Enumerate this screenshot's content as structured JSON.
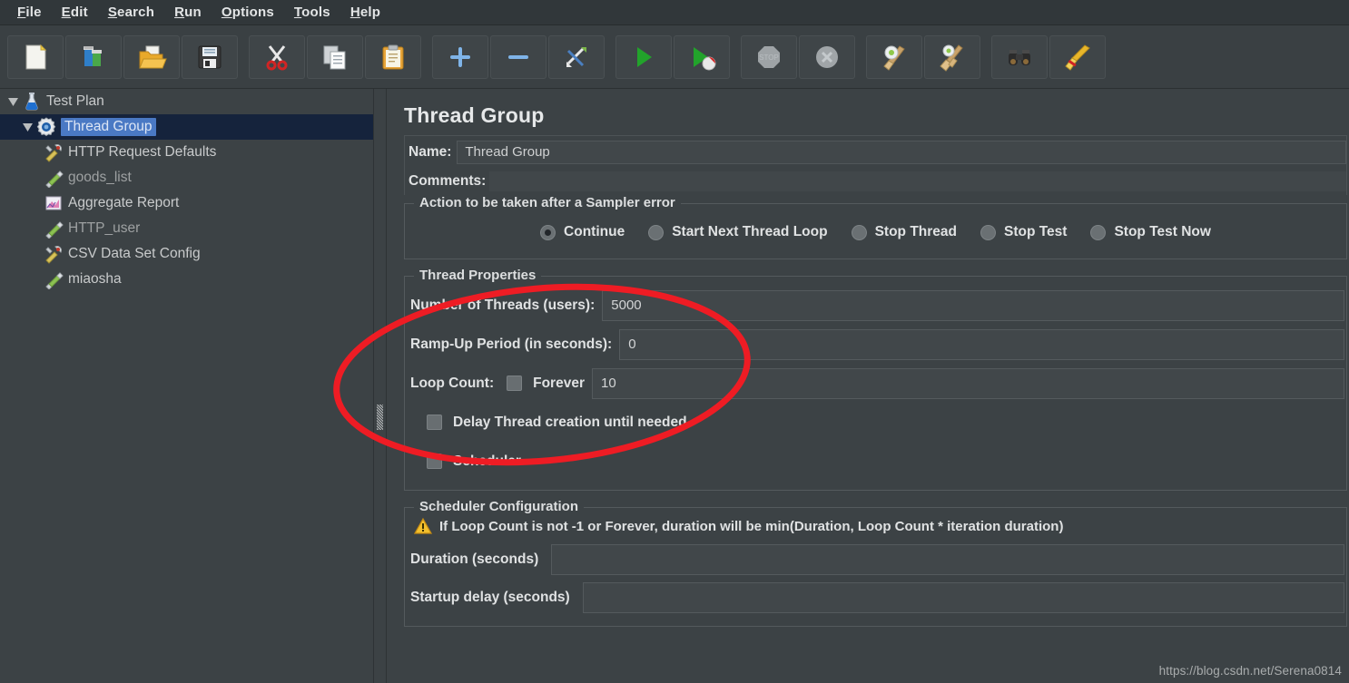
{
  "window": {
    "title": "Thread Group",
    "bg_color": "#3c4245",
    "accent_color": "#4a79c4",
    "annotation_color": "#ee1c24"
  },
  "menubar": {
    "items": [
      {
        "label": "File",
        "mnemonic": "F"
      },
      {
        "label": "Edit",
        "mnemonic": "E"
      },
      {
        "label": "Search",
        "mnemonic": "S"
      },
      {
        "label": "Run",
        "mnemonic": "R"
      },
      {
        "label": "Options",
        "mnemonic": "O"
      },
      {
        "label": "Tools",
        "mnemonic": "T"
      },
      {
        "label": "Help",
        "mnemonic": "H"
      }
    ]
  },
  "toolbar": {
    "buttons": [
      {
        "icon": "new-document-icon",
        "label": "New"
      },
      {
        "icon": "templates-icon",
        "label": "Templates"
      },
      {
        "icon": "open-folder-icon",
        "label": "Open"
      },
      {
        "icon": "save-floppy-icon",
        "label": "Save"
      },
      {
        "icon": "cut-scissors-icon",
        "label": "Cut"
      },
      {
        "icon": "copy-pages-icon",
        "label": "Copy"
      },
      {
        "icon": "paste-clipboard-icon",
        "label": "Paste"
      },
      {
        "icon": "expand-plus-icon",
        "label": "Expand All"
      },
      {
        "icon": "collapse-minus-icon",
        "label": "Collapse All"
      },
      {
        "icon": "toggle-enable-icon",
        "label": "Toggle"
      },
      {
        "icon": "start-play-icon",
        "label": "Start"
      },
      {
        "icon": "start-no-pauses-icon",
        "label": "Start no pauses"
      },
      {
        "icon": "stop-octagon-icon",
        "label": "Stop"
      },
      {
        "icon": "shutdown-circle-icon",
        "label": "Shutdown"
      },
      {
        "icon": "clear-broom-gear-icon",
        "label": "Clear"
      },
      {
        "icon": "clear-all-broom-icon",
        "label": "Clear All"
      },
      {
        "icon": "search-binoculars-icon",
        "label": "Search"
      },
      {
        "icon": "reset-broom-icon",
        "label": "Reset Search"
      }
    ]
  },
  "tree": {
    "items": [
      {
        "label": "Test Plan",
        "icon": "test-plan-flask-icon",
        "indent": 0,
        "toggle": "expanded",
        "selected": false,
        "enabled": true
      },
      {
        "label": "Thread Group",
        "icon": "thread-group-gear-icon",
        "indent": 1,
        "toggle": "expanded",
        "selected": true,
        "enabled": true
      },
      {
        "label": "HTTP Request Defaults",
        "icon": "config-wrench-icon",
        "indent": 2,
        "toggle": "none",
        "selected": false,
        "enabled": true
      },
      {
        "label": "goods_list",
        "icon": "sampler-pen-icon",
        "indent": 2,
        "toggle": "none",
        "selected": false,
        "enabled": false
      },
      {
        "label": "Aggregate Report",
        "icon": "listener-chart-icon",
        "indent": 2,
        "toggle": "none",
        "selected": false,
        "enabled": true
      },
      {
        "label": "HTTP_user",
        "icon": "sampler-pen-icon",
        "indent": 2,
        "toggle": "none",
        "selected": false,
        "enabled": false
      },
      {
        "label": "CSV Data Set Config",
        "icon": "config-wrench-icon",
        "indent": 2,
        "toggle": "none",
        "selected": false,
        "enabled": true
      },
      {
        "label": "miaosha",
        "icon": "sampler-pen-icon",
        "indent": 2,
        "toggle": "none",
        "selected": false,
        "enabled": true
      }
    ]
  },
  "panel": {
    "title": "Thread Group",
    "name_label": "Name:",
    "name_value": "Thread Group",
    "comments_label": "Comments:",
    "comments_value": "",
    "sampler_error": {
      "legend": "Action to be taken after a Sampler error",
      "options": [
        {
          "label": "Continue",
          "checked": true
        },
        {
          "label": "Start Next Thread Loop",
          "checked": false
        },
        {
          "label": "Stop Thread",
          "checked": false
        },
        {
          "label": "Stop Test",
          "checked": false
        },
        {
          "label": "Stop Test Now",
          "checked": false
        }
      ]
    },
    "thread_properties": {
      "legend": "Thread Properties",
      "num_threads_label": "Number of Threads (users):",
      "num_threads_value": "5000",
      "ramp_up_label": "Ramp-Up Period (in seconds):",
      "ramp_up_value": "0",
      "loop_count_label": "Loop Count:",
      "forever_label": "Forever",
      "forever_checked": false,
      "loop_count_value": "10",
      "delay_thread_label": "Delay Thread creation until needed",
      "delay_thread_checked": false,
      "scheduler_label": "Scheduler",
      "scheduler_checked": false
    },
    "scheduler_config": {
      "legend": "Scheduler Configuration",
      "warning_icon": "warning-triangle-icon",
      "warning_text": "If Loop Count is not -1 or Forever, duration will be min(Duration, Loop Count * iteration duration)",
      "duration_label": "Duration (seconds)",
      "duration_value": "",
      "startup_delay_label": "Startup delay (seconds)",
      "startup_delay_value": ""
    }
  },
  "watermark": {
    "text": "https://blog.csdn.net/Serena0814"
  }
}
